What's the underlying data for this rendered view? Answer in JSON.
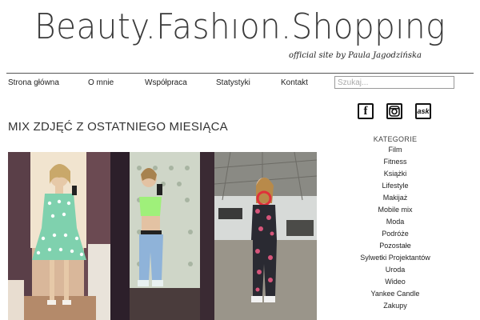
{
  "header": {
    "title": "Beauty.Fashıon.Shoppıng",
    "subtitle": "official site by Paula Jagodzińska"
  },
  "nav": {
    "items": [
      "Strona główna",
      "O mnie",
      "Współpraca",
      "Statystyki",
      "Kontakt"
    ],
    "search_placeholder": "Szukaj..."
  },
  "social": {
    "icons": [
      {
        "name": "facebook-icon",
        "glyph": "f"
      },
      {
        "name": "instagram-icon",
        "glyph": "◎"
      },
      {
        "name": "ask-icon",
        "glyph": "ask"
      }
    ]
  },
  "main": {
    "section_title": "MIX ZDJĘĆ Z OSTATNIEGO MIESIĄCA"
  },
  "sidebar": {
    "categories_heading": "KATEGORIE",
    "categories": [
      "Film",
      "Fitness",
      "Książki",
      "Lifestyle",
      "Makijaż",
      "Mobile mix",
      "Moda",
      "Podróże",
      "Pozostałe",
      "Sylwetki Projektantów",
      "Uroda",
      "Wideo",
      "Yankee Candle",
      "Zakupy"
    ]
  },
  "colors": {
    "text": "#222222",
    "rule": "#555555",
    "mint_dress": "#7fd1ae",
    "jeans": "#8fb3d9"
  }
}
